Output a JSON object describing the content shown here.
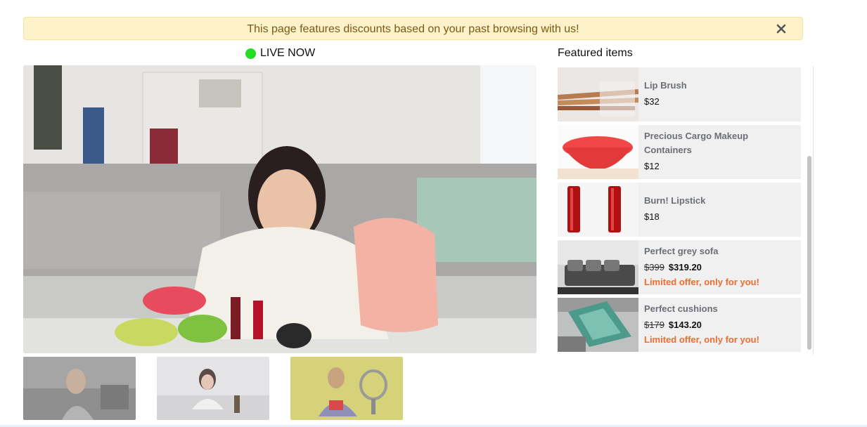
{
  "banner": {
    "message": "This page features discounts based on your past browsing with us!",
    "close_icon": "close-icon"
  },
  "stream": {
    "status_label": "LIVE NOW",
    "status_color": "#22dd22"
  },
  "featured": {
    "title": "Featured items",
    "items": [
      {
        "name": "Lip Brush",
        "price": "$32"
      },
      {
        "name": "Precious Cargo Makeup Containers",
        "price": "$12"
      },
      {
        "name": "Burn! Lipstick",
        "price": "$18"
      },
      {
        "name": "Perfect grey sofa",
        "old_price": "$399",
        "price": "$319.20",
        "offer": "Limited offer, only for you!"
      },
      {
        "name": "Perfect cushions",
        "old_price": "$179",
        "price": "$143.20",
        "offer": "Limited offer, only for you!"
      }
    ]
  },
  "colors": {
    "banner_bg": "#fdf2c9",
    "banner_text": "#7a5a14",
    "offer_text": "#ef6c2f"
  }
}
